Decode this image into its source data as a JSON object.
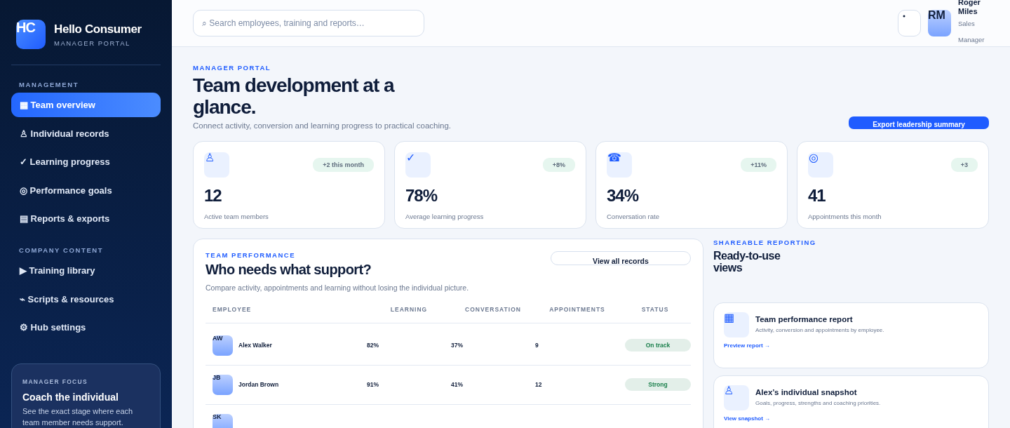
{
  "brand": {
    "logo": "HC",
    "name": "Hello Consumer",
    "subtitle": "MANAGER PORTAL"
  },
  "sidebar": {
    "sections": [
      {
        "heading": "MANAGEMENT",
        "items": [
          {
            "label": "▦ Team overview",
            "selected": true
          },
          {
            "label": "♙ Individual records",
            "selected": false
          },
          {
            "label": "✓ Learning progress",
            "selected": false
          },
          {
            "label": "◎ Performance goals",
            "selected": false
          },
          {
            "label": "▤ Reports & exports",
            "selected": false
          }
        ]
      },
      {
        "heading": "COMPANY CONTENT",
        "items": [
          {
            "label": "▶ Training library",
            "selected": false
          },
          {
            "label": "⌁ Scripts & resources",
            "selected": false
          },
          {
            "label": "⚙ Hub settings",
            "selected": false
          }
        ]
      }
    ],
    "focus": {
      "eyebrow": "MANAGER FOCUS",
      "title": "Coach the individual",
      "text": "See the exact stage where each team member needs support."
    }
  },
  "topbar": {
    "search": {
      "placeholder": "⌕ Search employees, training and reports…"
    },
    "user": {
      "initials": "RM",
      "name": "Roger Miles",
      "role": "Sales Manager"
    }
  },
  "header": {
    "eyebrow": "MANAGER PORTAL",
    "title": "Team development at a glance.",
    "subtitle": "Connect activity, conversion and learning progress to practical coaching.",
    "button": "Export leadership summary"
  },
  "stats": [
    {
      "icon": "♙",
      "badge": "+2 this month",
      "value": "12",
      "label": "Active team members"
    },
    {
      "icon": "✓",
      "badge": "+8%",
      "value": "78%",
      "label": "Average learning progress"
    },
    {
      "icon": "☎",
      "badge": "+11%",
      "value": "34%",
      "label": "Conversation rate"
    },
    {
      "icon": "◎",
      "badge": "+3",
      "value": "41",
      "label": "Appointments this month"
    }
  ],
  "performance": {
    "eyebrow": "TEAM PERFORMANCE",
    "title": "Who needs what support?",
    "subtitle": "Compare activity, appointments and learning without losing the individual picture.",
    "button": "View all records",
    "columns": [
      "EMPLOYEE",
      "LEARNING",
      "CONVERSATION",
      "APPOINTMENTS",
      "STATUS"
    ],
    "rows": [
      {
        "initials": "AW",
        "name": "Alex Walker",
        "learning": "82%",
        "conversation": "37%",
        "appointments": "9",
        "status": "On track",
        "color": "#1a7f4b"
      },
      {
        "initials": "JB",
        "name": "Jordan Brown",
        "learning": "91%",
        "conversation": "41%",
        "appointments": "12",
        "status": "Strong",
        "color": "#1a7f4b"
      },
      {
        "initials": "SK"
      }
    ]
  },
  "reporting": {
    "eyebrow": "SHAREABLE REPORTING",
    "title": "Ready-to-use views",
    "cards": [
      {
        "icon": "▦",
        "title": "Team performance report",
        "text": "Activity, conversion and appointments by employee.",
        "link": "Preview report →"
      },
      {
        "icon": "♙",
        "title": "Alex’s individual snapshot",
        "text": "Goals, progress, strengths and coaching priorities.",
        "link": "View snapshot →"
      }
    ]
  }
}
